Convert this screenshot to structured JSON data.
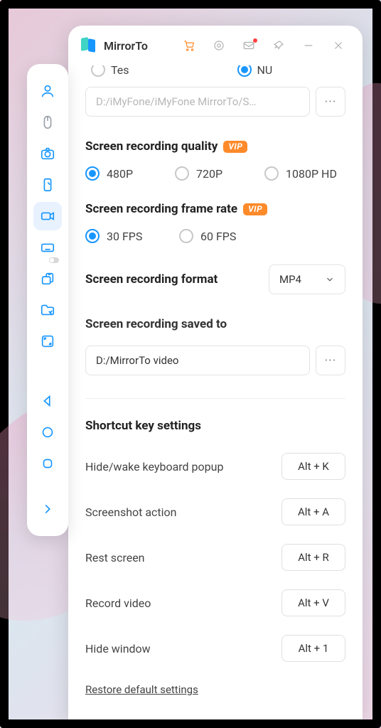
{
  "app": {
    "title": "MirrorTo"
  },
  "peek": {
    "opt1": "Tes",
    "opt2": "NU"
  },
  "screenshot_path": {
    "value": "D:/iMyFone/iMyFone MirrorTo/S…"
  },
  "quality": {
    "title": "Screen recording quality",
    "opts": [
      "480P",
      "720P",
      "1080P HD"
    ],
    "selected": 0
  },
  "framerate": {
    "title": "Screen recording frame rate",
    "opts": [
      "30 FPS",
      "60 FPS"
    ],
    "selected": 0
  },
  "format": {
    "title": "Screen recording format",
    "value": "MP4"
  },
  "saved": {
    "title": "Screen recording saved to",
    "value": "D:/MirrorTo video"
  },
  "shortcuts": {
    "title": "Shortcut key settings",
    "items": [
      {
        "label": "Hide/wake keyboard popup",
        "key": "Alt + K"
      },
      {
        "label": "Screenshot action",
        "key": "Alt + A"
      },
      {
        "label": "Rest screen",
        "key": "Alt + R"
      },
      {
        "label": "Record video",
        "key": "Alt + V"
      },
      {
        "label": "Hide window",
        "key": "Alt + 1"
      }
    ]
  },
  "restore": "Restore default settings",
  "vip": "VIP"
}
